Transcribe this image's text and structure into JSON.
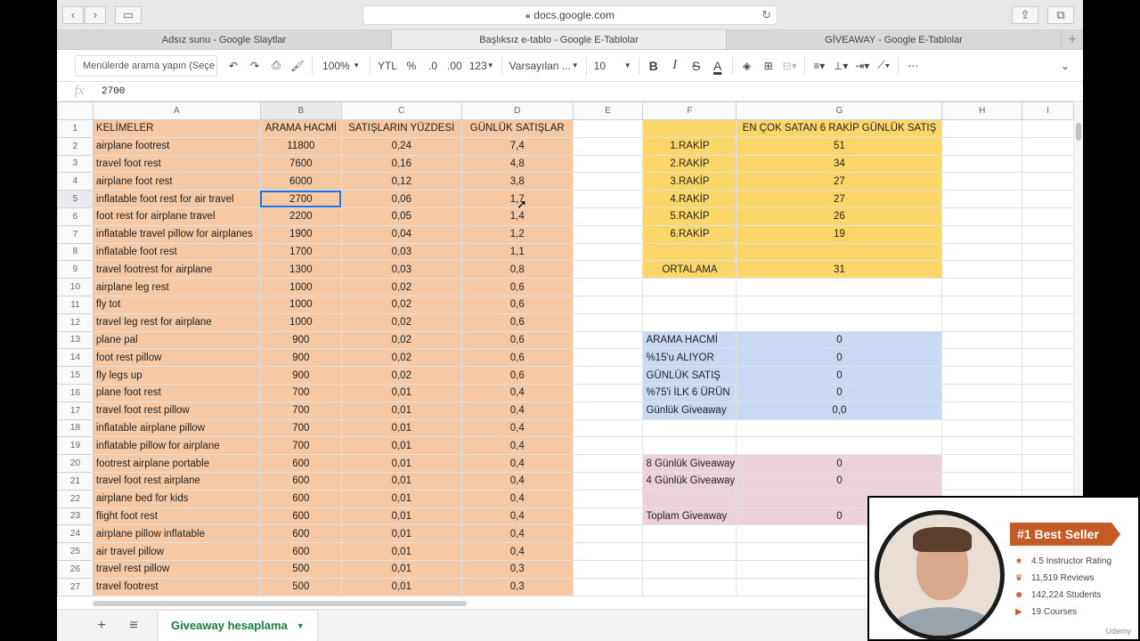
{
  "browser": {
    "url": "docs.google.com",
    "tabs": [
      "Adsız sunu - Google Slaytlar",
      "Başlıksız e-tablo - Google E-Tablolar",
      "GİVEAWAY - Google E-Tablolar"
    ]
  },
  "toolbar": {
    "menu_search_placeholder": "Menülerde arama yapın (Seçe",
    "zoom": "100%",
    "currency": "YTL",
    "percent": "%",
    "dec_less": ".0",
    "dec_more": ".00",
    "format": "123",
    "font": "Varsayılan ...",
    "font_size": "10",
    "bold": "B",
    "italic": "I",
    "strike": "S",
    "text_color": "A",
    "more": "⋯"
  },
  "formula": {
    "fx": "fx",
    "value": "2700"
  },
  "grid": {
    "columns": [
      "A",
      "B",
      "C",
      "D",
      "E",
      "F",
      "G",
      "H",
      "I"
    ],
    "rows": [
      {
        "n": "1",
        "a": "KELİMELER",
        "b": "ARAMA HACMİ",
        "c": "SATIŞLARIN YÜZDESİ",
        "d": "GÜNLÜK SATIŞLAR",
        "f": "",
        "g": "EN ÇOK SATAN 6 RAKİP GÜNLÜK SATIŞ"
      },
      {
        "n": "2",
        "a": "airplane footrest",
        "b": "11800",
        "c": "0,24",
        "d": "7,4",
        "f": "1.RAKİP",
        "g": "51"
      },
      {
        "n": "3",
        "a": "travel foot rest",
        "b": "7600",
        "c": "0,16",
        "d": "4,8",
        "f": "2.RAKİP",
        "g": "34"
      },
      {
        "n": "4",
        "a": "airplane foot rest",
        "b": "6000",
        "c": "0,12",
        "d": "3,8",
        "f": "3.RAKİP",
        "g": "27"
      },
      {
        "n": "5",
        "a": "inflatable foot rest for air travel",
        "b": "2700",
        "c": "0,06",
        "d": "1,7",
        "f": "4.RAKİP",
        "g": "27"
      },
      {
        "n": "6",
        "a": "foot rest for airplane travel",
        "b": "2200",
        "c": "0,05",
        "d": "1,4",
        "f": "5.RAKİP",
        "g": "26"
      },
      {
        "n": "7",
        "a": "inflatable travel pillow for airplanes",
        "b": "1900",
        "c": "0,04",
        "d": "1,2",
        "f": "6.RAKİP",
        "g": "19"
      },
      {
        "n": "8",
        "a": "inflatable foot rest",
        "b": "1700",
        "c": "0,03",
        "d": "1,1",
        "f": "",
        "g": ""
      },
      {
        "n": "9",
        "a": "travel footrest for airplane",
        "b": "1300",
        "c": "0,03",
        "d": "0,8",
        "f": "ORTALAMA",
        "g": "31"
      },
      {
        "n": "10",
        "a": "airplane leg rest",
        "b": "1000",
        "c": "0,02",
        "d": "0,6",
        "f": "",
        "g": ""
      },
      {
        "n": "11",
        "a": "fly tot",
        "b": "1000",
        "c": "0,02",
        "d": "0,6",
        "f": "",
        "g": ""
      },
      {
        "n": "12",
        "a": "travel leg rest for airplane",
        "b": "1000",
        "c": "0,02",
        "d": "0,6",
        "f": "",
        "g": ""
      },
      {
        "n": "13",
        "a": "plane pal",
        "b": "900",
        "c": "0,02",
        "d": "0,6",
        "f": "ARAMA HACMİ",
        "g": "0"
      },
      {
        "n": "14",
        "a": "foot rest pillow",
        "b": "900",
        "c": "0,02",
        "d": "0,6",
        "f": "%15'u ALIYOR",
        "g": "0"
      },
      {
        "n": "15",
        "a": "fly legs up",
        "b": "900",
        "c": "0,02",
        "d": "0,6",
        "f": "GÜNLÜK SATIŞ",
        "g": "0"
      },
      {
        "n": "16",
        "a": "plane foot rest",
        "b": "700",
        "c": "0,01",
        "d": "0,4",
        "f": "%75'i İLK 6 ÜRÜN",
        "g": "0"
      },
      {
        "n": "17",
        "a": "travel foot rest pillow",
        "b": "700",
        "c": "0,01",
        "d": "0,4",
        "f": "Günlük Giveaway",
        "g": "0,0"
      },
      {
        "n": "18",
        "a": "inflatable airplane pillow",
        "b": "700",
        "c": "0,01",
        "d": "0,4",
        "f": "",
        "g": ""
      },
      {
        "n": "19",
        "a": "inflatable pillow for airplane",
        "b": "700",
        "c": "0,01",
        "d": "0,4",
        "f": "",
        "g": ""
      },
      {
        "n": "20",
        "a": "footrest airplane portable",
        "b": "600",
        "c": "0,01",
        "d": "0,4",
        "f": "8 Günlük Giveaway",
        "g": "0"
      },
      {
        "n": "21",
        "a": "travel foot rest airplane",
        "b": "600",
        "c": "0,01",
        "d": "0,4",
        "f": "4 Günlük Giveaway",
        "g": "0"
      },
      {
        "n": "22",
        "a": "airplane bed for kids",
        "b": "600",
        "c": "0,01",
        "d": "0,4",
        "f": "",
        "g": ""
      },
      {
        "n": "23",
        "a": "flight foot rest",
        "b": "600",
        "c": "0,01",
        "d": "0,4",
        "f": "Toplam Giveaway",
        "g": "0"
      },
      {
        "n": "24",
        "a": "airplane pillow inflatable",
        "b": "600",
        "c": "0,01",
        "d": "0,4",
        "f": "",
        "g": ""
      },
      {
        "n": "25",
        "a": "air travel pillow",
        "b": "600",
        "c": "0,01",
        "d": "0,4",
        "f": "",
        "g": ""
      },
      {
        "n": "26",
        "a": "travel rest pillow",
        "b": "500",
        "c": "0,01",
        "d": "0,3",
        "f": "",
        "g": ""
      },
      {
        "n": "27",
        "a": "travel footrest",
        "b": "500",
        "c": "0,01",
        "d": "0,3",
        "f": "",
        "g": ""
      }
    ]
  },
  "sheet_tab": "Giveaway hesaplama",
  "instructor": {
    "badge": "#1 Best Seller",
    "stats": [
      "4.5 Instructor Rating",
      "11,519 Reviews",
      "142,224 Students",
      "19 Courses"
    ],
    "watermark": "Udemy"
  },
  "colors": {
    "orange": "#f6c9a4",
    "yellow": "#fbd76a",
    "blue": "#c9d8f5",
    "pink": "#ead1dc",
    "selection": "#1a73e8"
  }
}
